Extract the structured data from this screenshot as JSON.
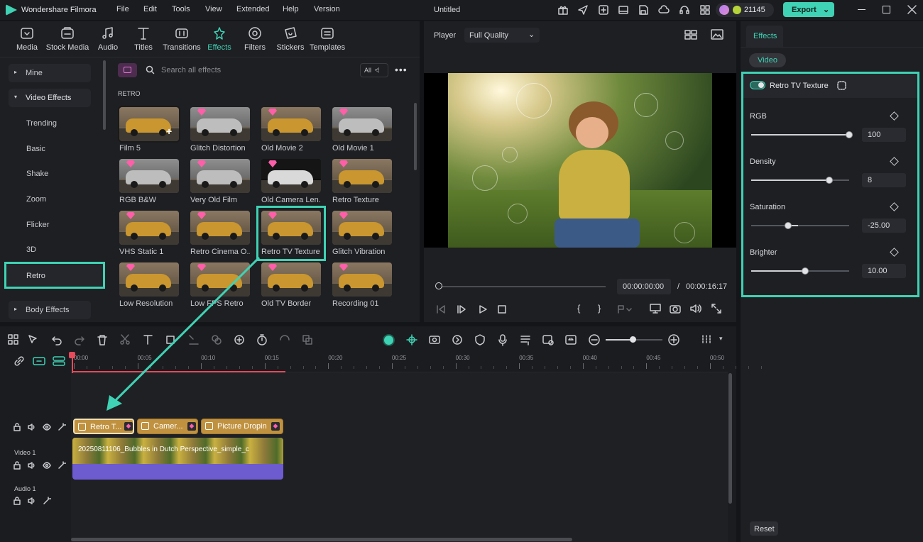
{
  "app": {
    "name": "Wondershare Filmora",
    "project_title": "Untitled",
    "credits": "21145",
    "export_label": "Export",
    "accent_color": "#3fd2b4"
  },
  "menu": [
    "File",
    "Edit",
    "Tools",
    "View",
    "Extended",
    "Help",
    "Version"
  ],
  "media_tabs": [
    {
      "label": "Media",
      "icon": "media-icon"
    },
    {
      "label": "Stock Media",
      "icon": "stock-media-icon"
    },
    {
      "label": "Audio",
      "icon": "audio-icon"
    },
    {
      "label": "Titles",
      "icon": "titles-icon"
    },
    {
      "label": "Transitions",
      "icon": "transitions-icon"
    },
    {
      "label": "Effects",
      "icon": "effects-icon"
    },
    {
      "label": "Filters",
      "icon": "filters-icon"
    },
    {
      "label": "Stickers",
      "icon": "stickers-icon"
    },
    {
      "label": "Templates",
      "icon": "templates-icon"
    }
  ],
  "sidebar": {
    "mine": "Mine",
    "video_effects": "Video Effects",
    "items": [
      "Trending",
      "Basic",
      "Shake",
      "Zoom",
      "Flicker",
      "3D",
      "Retro"
    ],
    "selected": "Retro",
    "body_effects": "Body Effects"
  },
  "effects": {
    "search_placeholder": "Search all effects",
    "filter_label": "All",
    "section": "RETRO",
    "items": [
      "Film 5",
      "Glitch Distortion",
      "Old Movie 2",
      "Old Movie 1",
      "RGB B&W",
      "Very Old Film",
      "Old Camera Len...",
      "Retro Texture",
      "VHS Static 1",
      "Retro Cinema O...",
      "Retro TV Texture",
      "Glitch Vibration",
      "Low Resolution",
      "Low FPS Retro",
      "Old TV Border",
      "Recording 01"
    ]
  },
  "player": {
    "label": "Player",
    "quality": "Full Quality",
    "current_time": "00:00:00:00",
    "separator": "/",
    "total_time": "00:00:16:17"
  },
  "properties": {
    "tab": "Effects",
    "subtab": "Video",
    "effect_name": "Retro TV Texture",
    "params": [
      {
        "label": "RGB",
        "value": "100",
        "level": 1.0
      },
      {
        "label": "Density",
        "value": "8",
        "level": 0.8
      },
      {
        "label": "Saturation",
        "value": "-25.00",
        "level": 0.375
      },
      {
        "label": "Brighter",
        "value": "10.00",
        "level": 0.55
      }
    ],
    "reset_label": "Reset"
  },
  "timeline": {
    "ticks": [
      "00:00",
      "00:05",
      "00:10",
      "00:15",
      "00:20",
      "00:25",
      "00:30",
      "00:35",
      "00:40",
      "00:45",
      "00:50"
    ],
    "effect_clips": [
      "Retro T...",
      "Camer...",
      "Picture Dropin"
    ],
    "video_track": "Video 1",
    "audio_track": "Audio 1",
    "video_clip": "20250811106_Bubbles in Dutch Perspective_simple_c"
  }
}
